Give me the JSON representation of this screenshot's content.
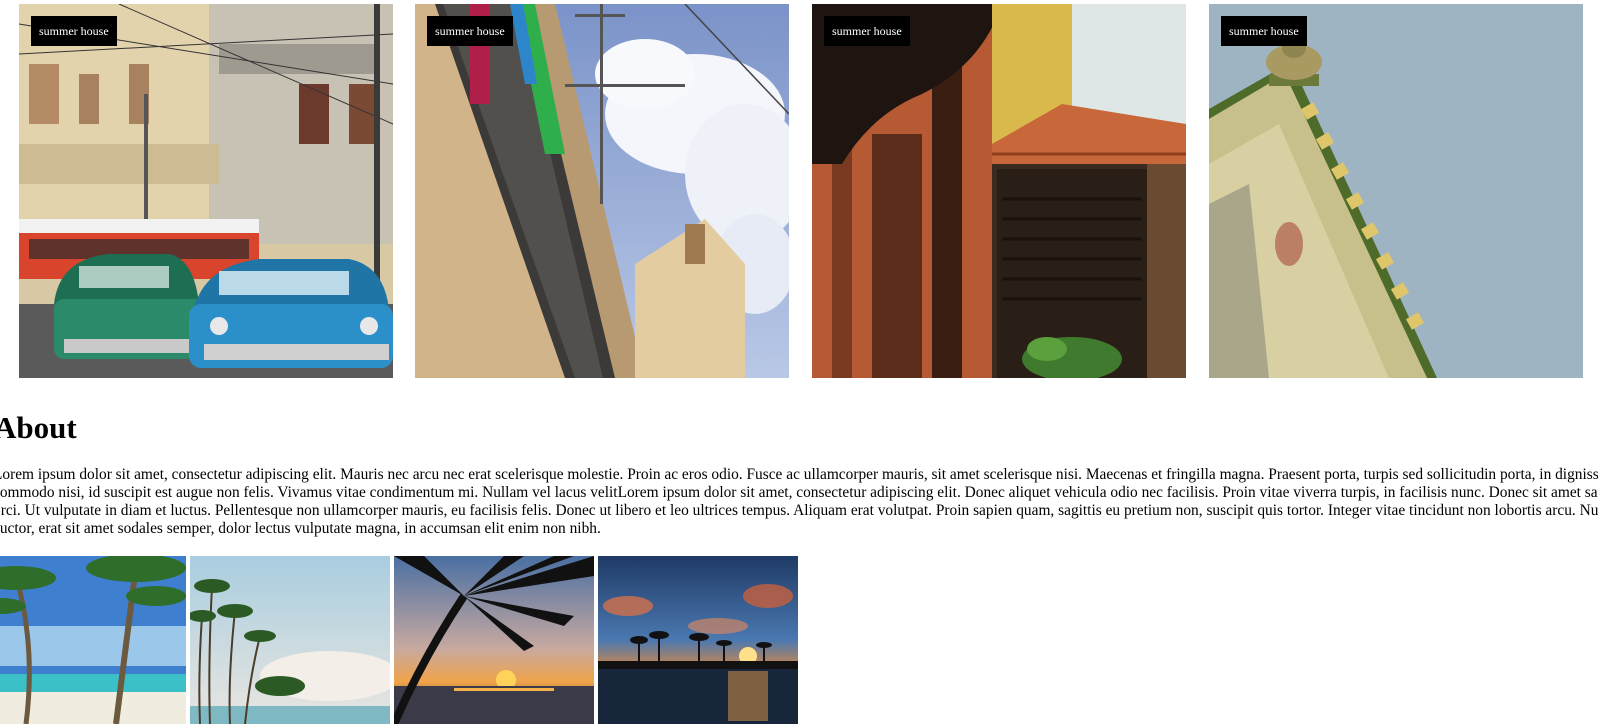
{
  "gallery": {
    "items": [
      {
        "badge": "summer house",
        "icon": "havana-street-photo"
      },
      {
        "badge": "summer house",
        "icon": "balcony-sky-photo"
      },
      {
        "badge": "summer house",
        "icon": "wooden-balcony-photo"
      },
      {
        "badge": "summer house",
        "icon": "cornice-sky-photo"
      }
    ]
  },
  "about": {
    "title": "About",
    "text": "Lorem ipsum dolor sit amet, consectetur adipiscing elit. Mauris nec arcu nec erat scelerisque molestie. Proin ac eros odio. Fusce ac ullamcorper mauris, sit amet scelerisque nisi. Maecenas et fringilla magna. Praesent porta, turpis sed sollicitudin porta, in dignissim commodo nisi, id suscipit est augue non felis. Vivamus vitae condimentum mi. Nullam vel lacus velitLorem ipsum dolor sit amet, consectetur adipiscing elit. Donec aliquet vehicula odio nec facilisis. Proin vitae viverra turpis, in facilisis nunc. Donec sit amet sapien orci. Ut vulputate in diam et luctus. Pellentesque non ullamcorper mauris, eu facilisis felis. Donec ut libero et leo ultrices tempus. Aliquam erat volutpat. Proin sapien quam, sagittis eu pretium non, suscipit quis tortor. Integer vitae tincidunt non lobortis arcu. Nunc auctor, erat sit amet sodales semper, dolor lectus vulputate magna, in accumsan elit enim non nibh."
  },
  "photos": {
    "items": [
      {
        "icon": "palm-beach-photo"
      },
      {
        "icon": "palm-shore-photo"
      },
      {
        "icon": "palm-sunset-photo"
      },
      {
        "icon": "lagoon-sunset-photo"
      }
    ]
  },
  "colors": {
    "badge_bg": "#000000",
    "badge_text": "#ffffff",
    "background": "#ffffff"
  }
}
